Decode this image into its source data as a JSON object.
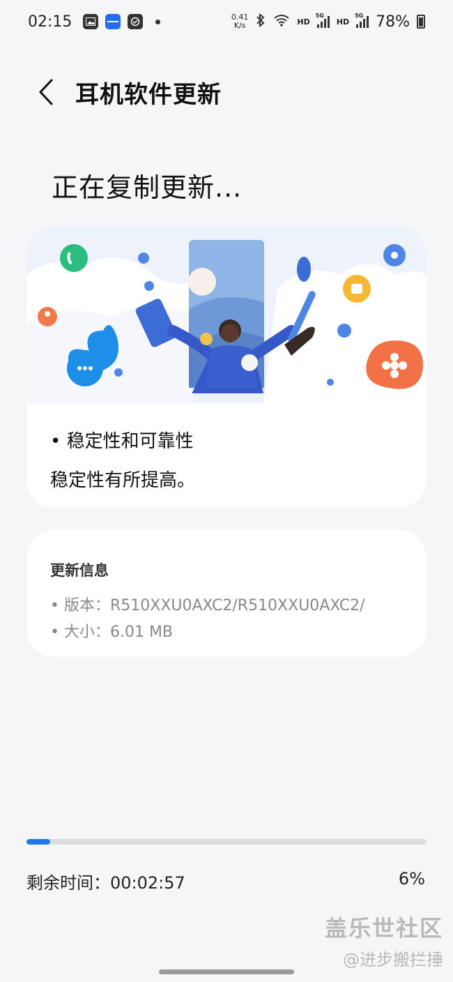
{
  "status_bar": {
    "time": "02:15",
    "net_speed_value": "0.41",
    "net_speed_unit": "K/s",
    "hd1": "HD",
    "hd2": "HD",
    "g1": "5G",
    "g2": "5G",
    "battery": "78%",
    "icons": [
      "photo-icon",
      "samsung-app-icon",
      "clock-app-icon",
      "bluetooth-icon",
      "wifi-icon",
      "signal-icon",
      "battery-icon"
    ]
  },
  "header": {
    "title": "耳机软件更新"
  },
  "main": {
    "heading": "正在复制更新...",
    "release_note_item": "• 稳定性和可靠性",
    "release_note_desc": "稳定性有所提高。"
  },
  "info": {
    "title": "更新信息",
    "version_line": "• 版本：R510XXU0AXC2/R510XXU0AXC2/",
    "size_line": "• 大小：6.01 MB"
  },
  "progress": {
    "percent_value": 6,
    "remaining_label": "剩余时间：00:02:57",
    "percent_label": "6%"
  },
  "watermark": {
    "line1": "盖乐世社区",
    "line2": "@进步搬拦捶"
  },
  "colors": {
    "accent": "#1e7bea",
    "background": "#f6f6f8"
  }
}
